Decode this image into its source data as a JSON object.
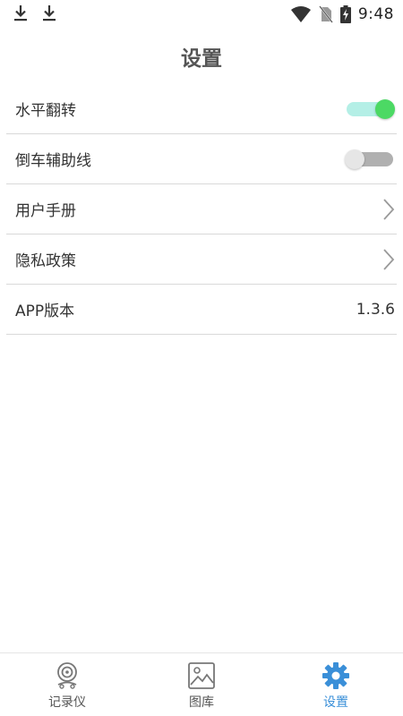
{
  "status_bar": {
    "time": "9:48",
    "icons": [
      "download-icon",
      "download-icon",
      "wifi-icon",
      "no-sim-icon",
      "battery-charging-icon"
    ]
  },
  "header": {
    "title": "设置"
  },
  "settings": {
    "flip_horizontal": {
      "label": "水平翻转",
      "enabled": true
    },
    "reverse_guide": {
      "label": "倒车辅助线",
      "enabled": false
    },
    "user_manual": {
      "label": "用户手册"
    },
    "privacy_policy": {
      "label": "隐私政策"
    },
    "app_version": {
      "label": "APP版本",
      "value": "1.3.6"
    }
  },
  "bottom_nav": {
    "recorder": {
      "label": "记录仪",
      "icon": "dashcam-icon"
    },
    "gallery": {
      "label": "图库",
      "icon": "gallery-icon"
    },
    "settings": {
      "label": "设置",
      "icon": "gear-icon",
      "active": true
    }
  },
  "colors": {
    "accent": "#3a8fd8",
    "toggle_on_thumb": "#4cd964",
    "toggle_on_track": "#b4efe6",
    "toggle_off_track": "#b0b0b0",
    "divider": "#d9d9d9"
  }
}
